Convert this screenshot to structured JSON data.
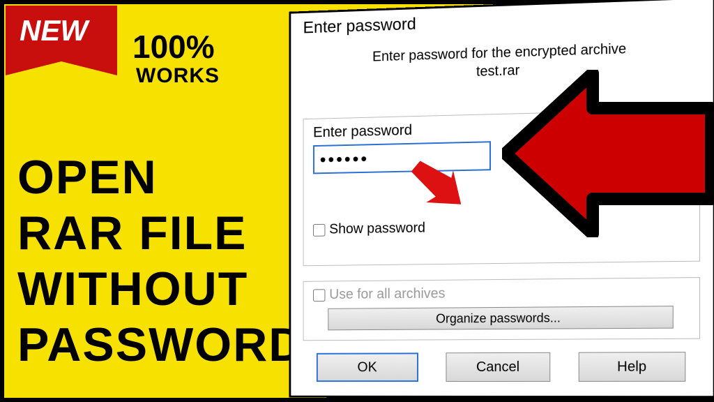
{
  "badge": {
    "new": "NEW"
  },
  "promo": {
    "percent": "100%",
    "works": "WORKS"
  },
  "title": {
    "l1": "OPEN",
    "l2": "RAR FILE",
    "l3": "WITHOUT",
    "l4": "PASSWORD"
  },
  "dialog": {
    "title": "Enter password",
    "instruction_line1": "Enter password for the encrypted archive",
    "instruction_filename": "test.rar",
    "field_label": "Enter password",
    "password_value": "••••••",
    "show_password": "Show password",
    "use_all": "Use for all archives",
    "organize": "Organize passwords...",
    "ok": "OK",
    "cancel": "Cancel",
    "help": "Help"
  }
}
